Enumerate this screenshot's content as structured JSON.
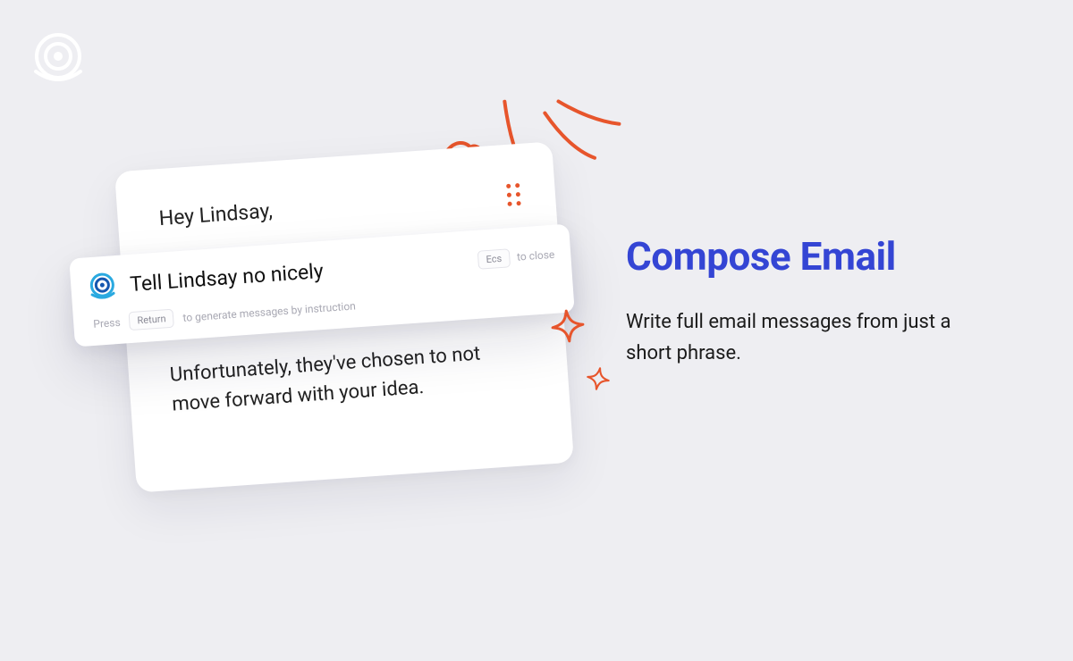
{
  "headline": "Compose Email",
  "subhead": "Write full email messages from just a short phrase.",
  "card": {
    "greeting": "Hey Lindsay,",
    "body": "Unfortunately, they've chosen to not move forward with your idea."
  },
  "prompt": {
    "text": "Tell Lindsay no nicely",
    "close_key": "Ecs",
    "close_label": "to close",
    "press_label": "Press",
    "return_key": "Return",
    "generate_label": "to generate messages by instruction"
  }
}
